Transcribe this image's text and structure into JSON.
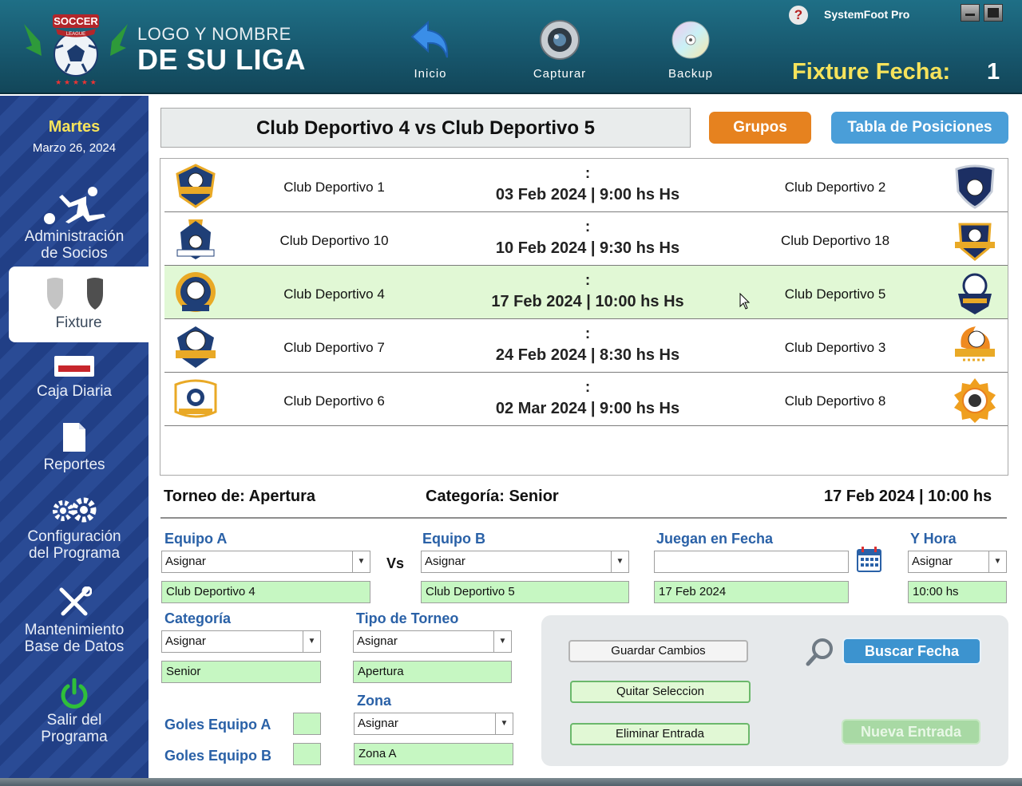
{
  "header": {
    "logo_text": "SOCCER LEAGUE",
    "league_line1": "LOGO Y NOMBRE",
    "league_line2": "DE SU LIGA",
    "tools": [
      {
        "label": "Inicio",
        "icon": "undo-arrow-icon"
      },
      {
        "label": "Capturar",
        "icon": "camera-lens-icon"
      },
      {
        "label": "Backup",
        "icon": "disc-icon"
      }
    ],
    "help": "?",
    "brand": "SystemFoot Pro",
    "fixture_label": "Fixture Fecha:",
    "fixture_number": "1"
  },
  "sidebar": {
    "day": "Martes",
    "date": "Marzo 26, 2024",
    "items": [
      {
        "label_1": "Administración",
        "label_2": "de Socios",
        "icon": "soccer-player-icon"
      },
      {
        "label_1": "Fixture",
        "icon": "shields-icon"
      },
      {
        "label_1": "Caja Diaria",
        "icon": "cash-register-icon"
      },
      {
        "label_1": "Reportes",
        "icon": "report-icon"
      },
      {
        "label_1": "Configuración",
        "label_2": "del Programa",
        "icon": "gears-icon"
      },
      {
        "label_1": "Mantenimiento",
        "label_2": "Base de Datos",
        "icon": "tools-icon"
      },
      {
        "label_1": "Salir del",
        "label_2": "Programa",
        "icon": "power-icon"
      }
    ]
  },
  "main": {
    "title": "Club Deportivo 4 vs Club Deportivo 5",
    "grupos_label": "Grupos",
    "tabla_label": "Tabla de Posiciones",
    "matches": [
      {
        "team_a": "Club Deportivo 1",
        "team_b": "Club Deportivo 2",
        "score": ":",
        "datetime": "03 Feb 2024 | 9:00 hs Hs"
      },
      {
        "team_a": "Club Deportivo 10",
        "team_b": "Club Deportivo 18",
        "score": ":",
        "datetime": "10 Feb 2024 | 9:30 hs Hs"
      },
      {
        "team_a": "Club Deportivo 4",
        "team_b": "Club Deportivo 5",
        "score": ":",
        "datetime": "17 Feb 2024 | 10:00 hs Hs"
      },
      {
        "team_a": "Club Deportivo 7",
        "team_b": "Club Deportivo 3",
        "score": ":",
        "datetime": "24 Feb 2024 | 8:30 hs Hs"
      },
      {
        "team_a": "Club Deportivo 6",
        "team_b": "Club Deportivo 8",
        "score": ":",
        "datetime": "02 Mar 2024 | 9:00 hs Hs"
      }
    ],
    "torneo": "Torneo de: Apertura",
    "categoria": "Categoría: Senior",
    "fecha_hora": "17 Feb 2024 | 10:00 hs"
  },
  "form": {
    "equipo_a_label": "Equipo A",
    "equipo_b_label": "Equipo B",
    "fecha_label": "Juegan en Fecha",
    "hora_label": "Y Hora",
    "vs": "Vs",
    "assign": "Asignar",
    "equipo_a_value": "Club Deportivo 4",
    "equipo_b_value": "Club Deportivo 5",
    "fecha_value": "17 Feb 2024",
    "hora_value": "10:00 hs",
    "categoria_label": "Categoría",
    "tipo_label": "Tipo de Torneo",
    "categoria_value": "Senior",
    "tipo_value": "Apertura",
    "zona_label": "Zona",
    "zona_value": "Zona A",
    "goles_a_label": "Goles Equipo A",
    "goles_b_label": "Goles Equipo B"
  },
  "actions": {
    "guardar": "Guardar Cambios",
    "quitar": "Quitar Seleccion",
    "eliminar": "Eliminar Entrada",
    "buscar": "Buscar Fecha",
    "nueva": "Nueva Entrada"
  },
  "colors": {
    "header_bg": "#17566c",
    "sidebar_bg": "#213f86",
    "accent_yellow": "#f6e35b",
    "label_blue": "#2a61a7",
    "field_green": "#c6f7c2",
    "button_orange": "#e6821f",
    "button_blue": "#4a9ed8"
  }
}
